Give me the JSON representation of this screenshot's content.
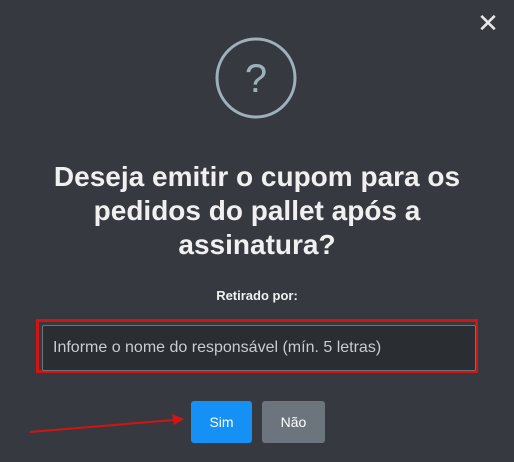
{
  "dialog": {
    "close_glyph": "✕",
    "icon": "question-circle-icon",
    "icon_glyph": "?",
    "title": "Deseja emitir o cupom para os pedidos do pallet após a assinatura?",
    "field_label": "Retirado por:",
    "input_placeholder": "Informe o nome do responsável (mín. 5 letras)",
    "input_value": "",
    "confirm_label": "Sim",
    "cancel_label": "Não"
  },
  "colors": {
    "modal_bg": "#363a40",
    "confirm": "#1591f5",
    "cancel": "#6c757d",
    "highlight": "#d11515",
    "icon": "#9fb0bb"
  }
}
